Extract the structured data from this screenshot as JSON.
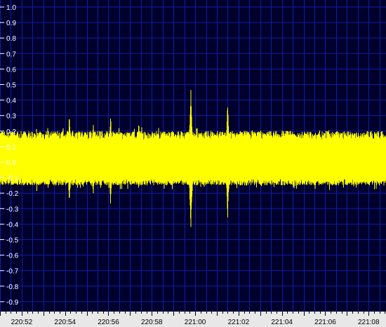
{
  "colors": {
    "background": "#000000",
    "plot_background": "#00002c",
    "grid": "#0d1fa6",
    "signal": "#ffff00",
    "axis_text": "#ffffff",
    "x_axis_background": "#e8e8e8",
    "x_axis_text": "#000000"
  },
  "chart_data": {
    "type": "line",
    "title": "",
    "xlabel": "",
    "ylabel": "",
    "ylim": [
      -1.0,
      1.0
    ],
    "xlim": [
      "220:51",
      "221:08.8"
    ],
    "y_ticks": [
      "1.0",
      "0.9",
      "0.8",
      "0.7",
      "0.6",
      "0.5",
      "0.4",
      "0.3",
      "0.2",
      "0.1",
      "0.0",
      "-0.1",
      "-0.2",
      "-0.3",
      "-0.4",
      "-0.5",
      "-0.6",
      "-0.7",
      "-0.8",
      "-0.9"
    ],
    "x_ticks": [
      "220:52",
      "220:54",
      "220:56",
      "220:58",
      "221:00",
      "221:02",
      "221:04",
      "221:06",
      "221:08"
    ],
    "grid": true,
    "series": [
      {
        "noise_band_upper": 0.2,
        "noise_band_lower": -0.15,
        "spikes": [
          {
            "t": "220:54.2",
            "max": 0.34,
            "min": -0.28
          },
          {
            "t": "220:55.3",
            "max": 0.28,
            "min": -0.22
          },
          {
            "t": "220:56.1",
            "max": 0.33,
            "min": -0.28
          },
          {
            "t": "220:57.4",
            "max": 0.27,
            "min": -0.2
          },
          {
            "t": "220:59.8",
            "max": 0.5,
            "min": -0.46
          },
          {
            "t": "221:01.5",
            "max": 0.42,
            "min": -0.37
          }
        ]
      }
    ]
  }
}
